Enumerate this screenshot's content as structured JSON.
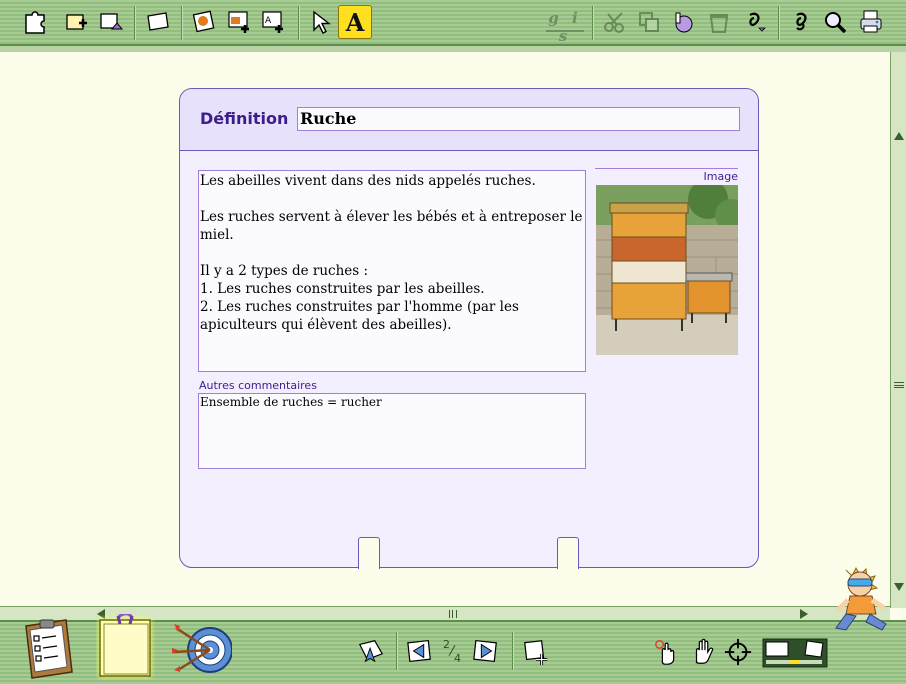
{
  "card": {
    "type_label": "Définition",
    "title": "Ruche",
    "body": "Les abeilles vivent dans des nids appelés ruches.\n\nLes ruches servent à élever les bébés et à entreposer le miel.\n\nIl y a 2 types de ruches :\n1. Les ruches construites par les abeilles.\n2. Les ruches construites par l'homme (par les apiculteurs qui élèvent des abeilles).",
    "image_label": "Image",
    "comments_label": "Autres commentaires",
    "comments": "Ensemble de ruches = rucher"
  },
  "toolbar_top": {
    "text_tool_label": "A",
    "style_letters": "g i s"
  },
  "pager": {
    "current": "2",
    "total": "4"
  },
  "colors": {
    "toolbar": "#a7cc93",
    "card_border": "#6a5ab8",
    "card_bg": "#f3efff",
    "accent_text": "#3c1e8a",
    "active_tool": "#ffe020"
  }
}
